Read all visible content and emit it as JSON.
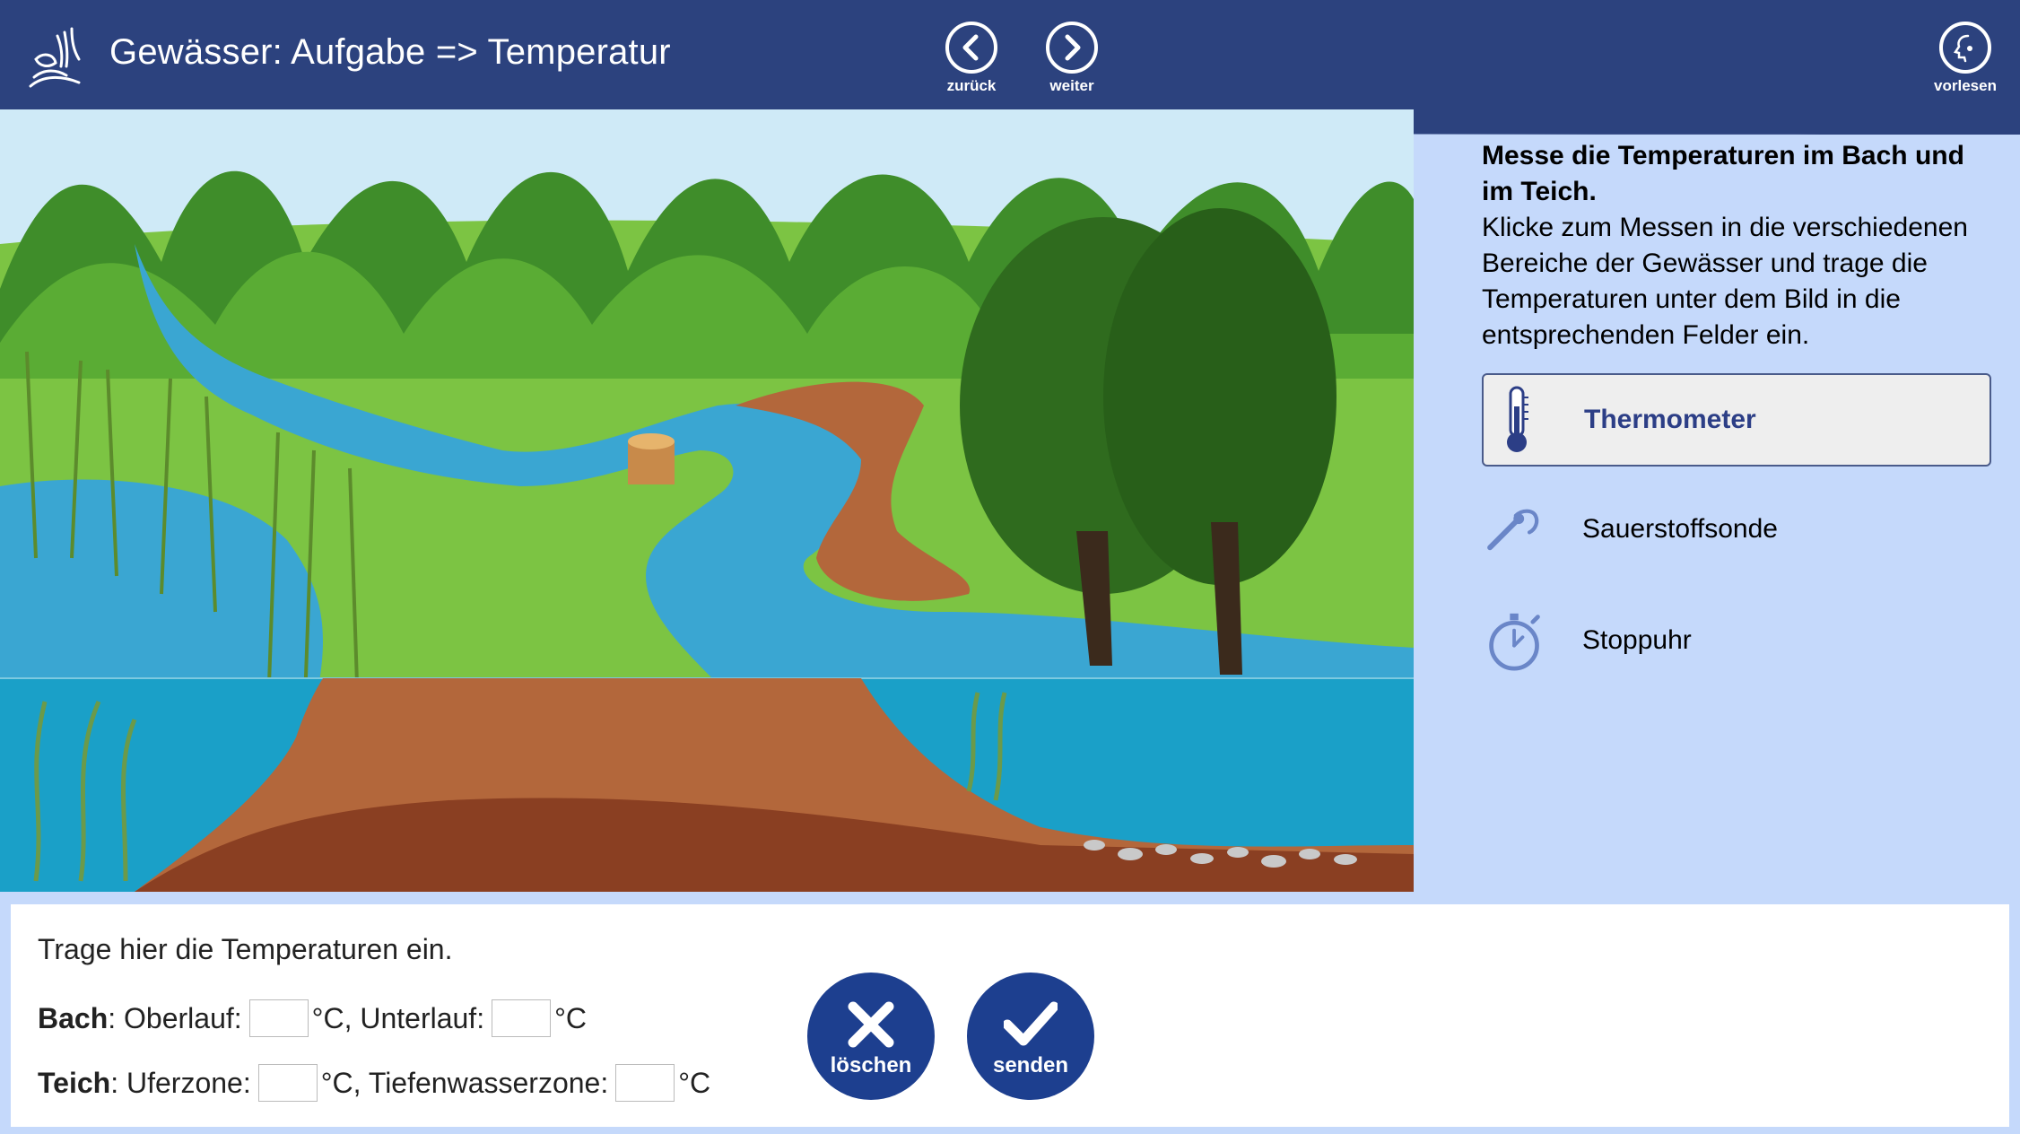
{
  "header": {
    "title": "Gewässer: Aufgabe => Temperatur",
    "back_label": "zurück",
    "next_label": "weiter",
    "read_label": "vorlesen"
  },
  "instructions": {
    "heading": "Messe die Temperaturen im Bach und im Teich.",
    "body": "Klicke zum Messen in die verschiedenen Bereiche der Gewässer und trage die Temperaturen unter dem Bild in die entsprechenden Felder ein."
  },
  "tools": [
    {
      "label": "Thermometer",
      "icon": "thermometer-icon",
      "selected": true
    },
    {
      "label": "Sauerstoffsonde",
      "icon": "oxygen-probe-icon",
      "selected": false
    },
    {
      "label": "Stoppuhr",
      "icon": "stopwatch-icon",
      "selected": false
    }
  ],
  "form": {
    "title": "Trage hier die Temperaturen ein.",
    "bach": {
      "label": "Bach",
      "oberlauf_label": ": Oberlauf:",
      "unterlauf_label": "°C, Unterlauf:",
      "unit_end": "°C",
      "oberlauf_value": "",
      "unterlauf_value": ""
    },
    "teich": {
      "label": "Teich",
      "uferzone_label": ": Uferzone:",
      "tiefenwasser_label": "°C, Tiefenwasserzone:",
      "unit_end": "°C",
      "uferzone_value": "",
      "tiefenwasser_value": ""
    }
  },
  "buttons": {
    "clear_label": "löschen",
    "send_label": "senden"
  },
  "colors": {
    "header": "#2c427e",
    "panel_bg": "#c5d9fb",
    "button_blue": "#1d3f8f",
    "selected_tool_text": "#2c3e86",
    "water": "#3aa6d2",
    "grass": "#7cc443",
    "soil": "#b3673b"
  }
}
